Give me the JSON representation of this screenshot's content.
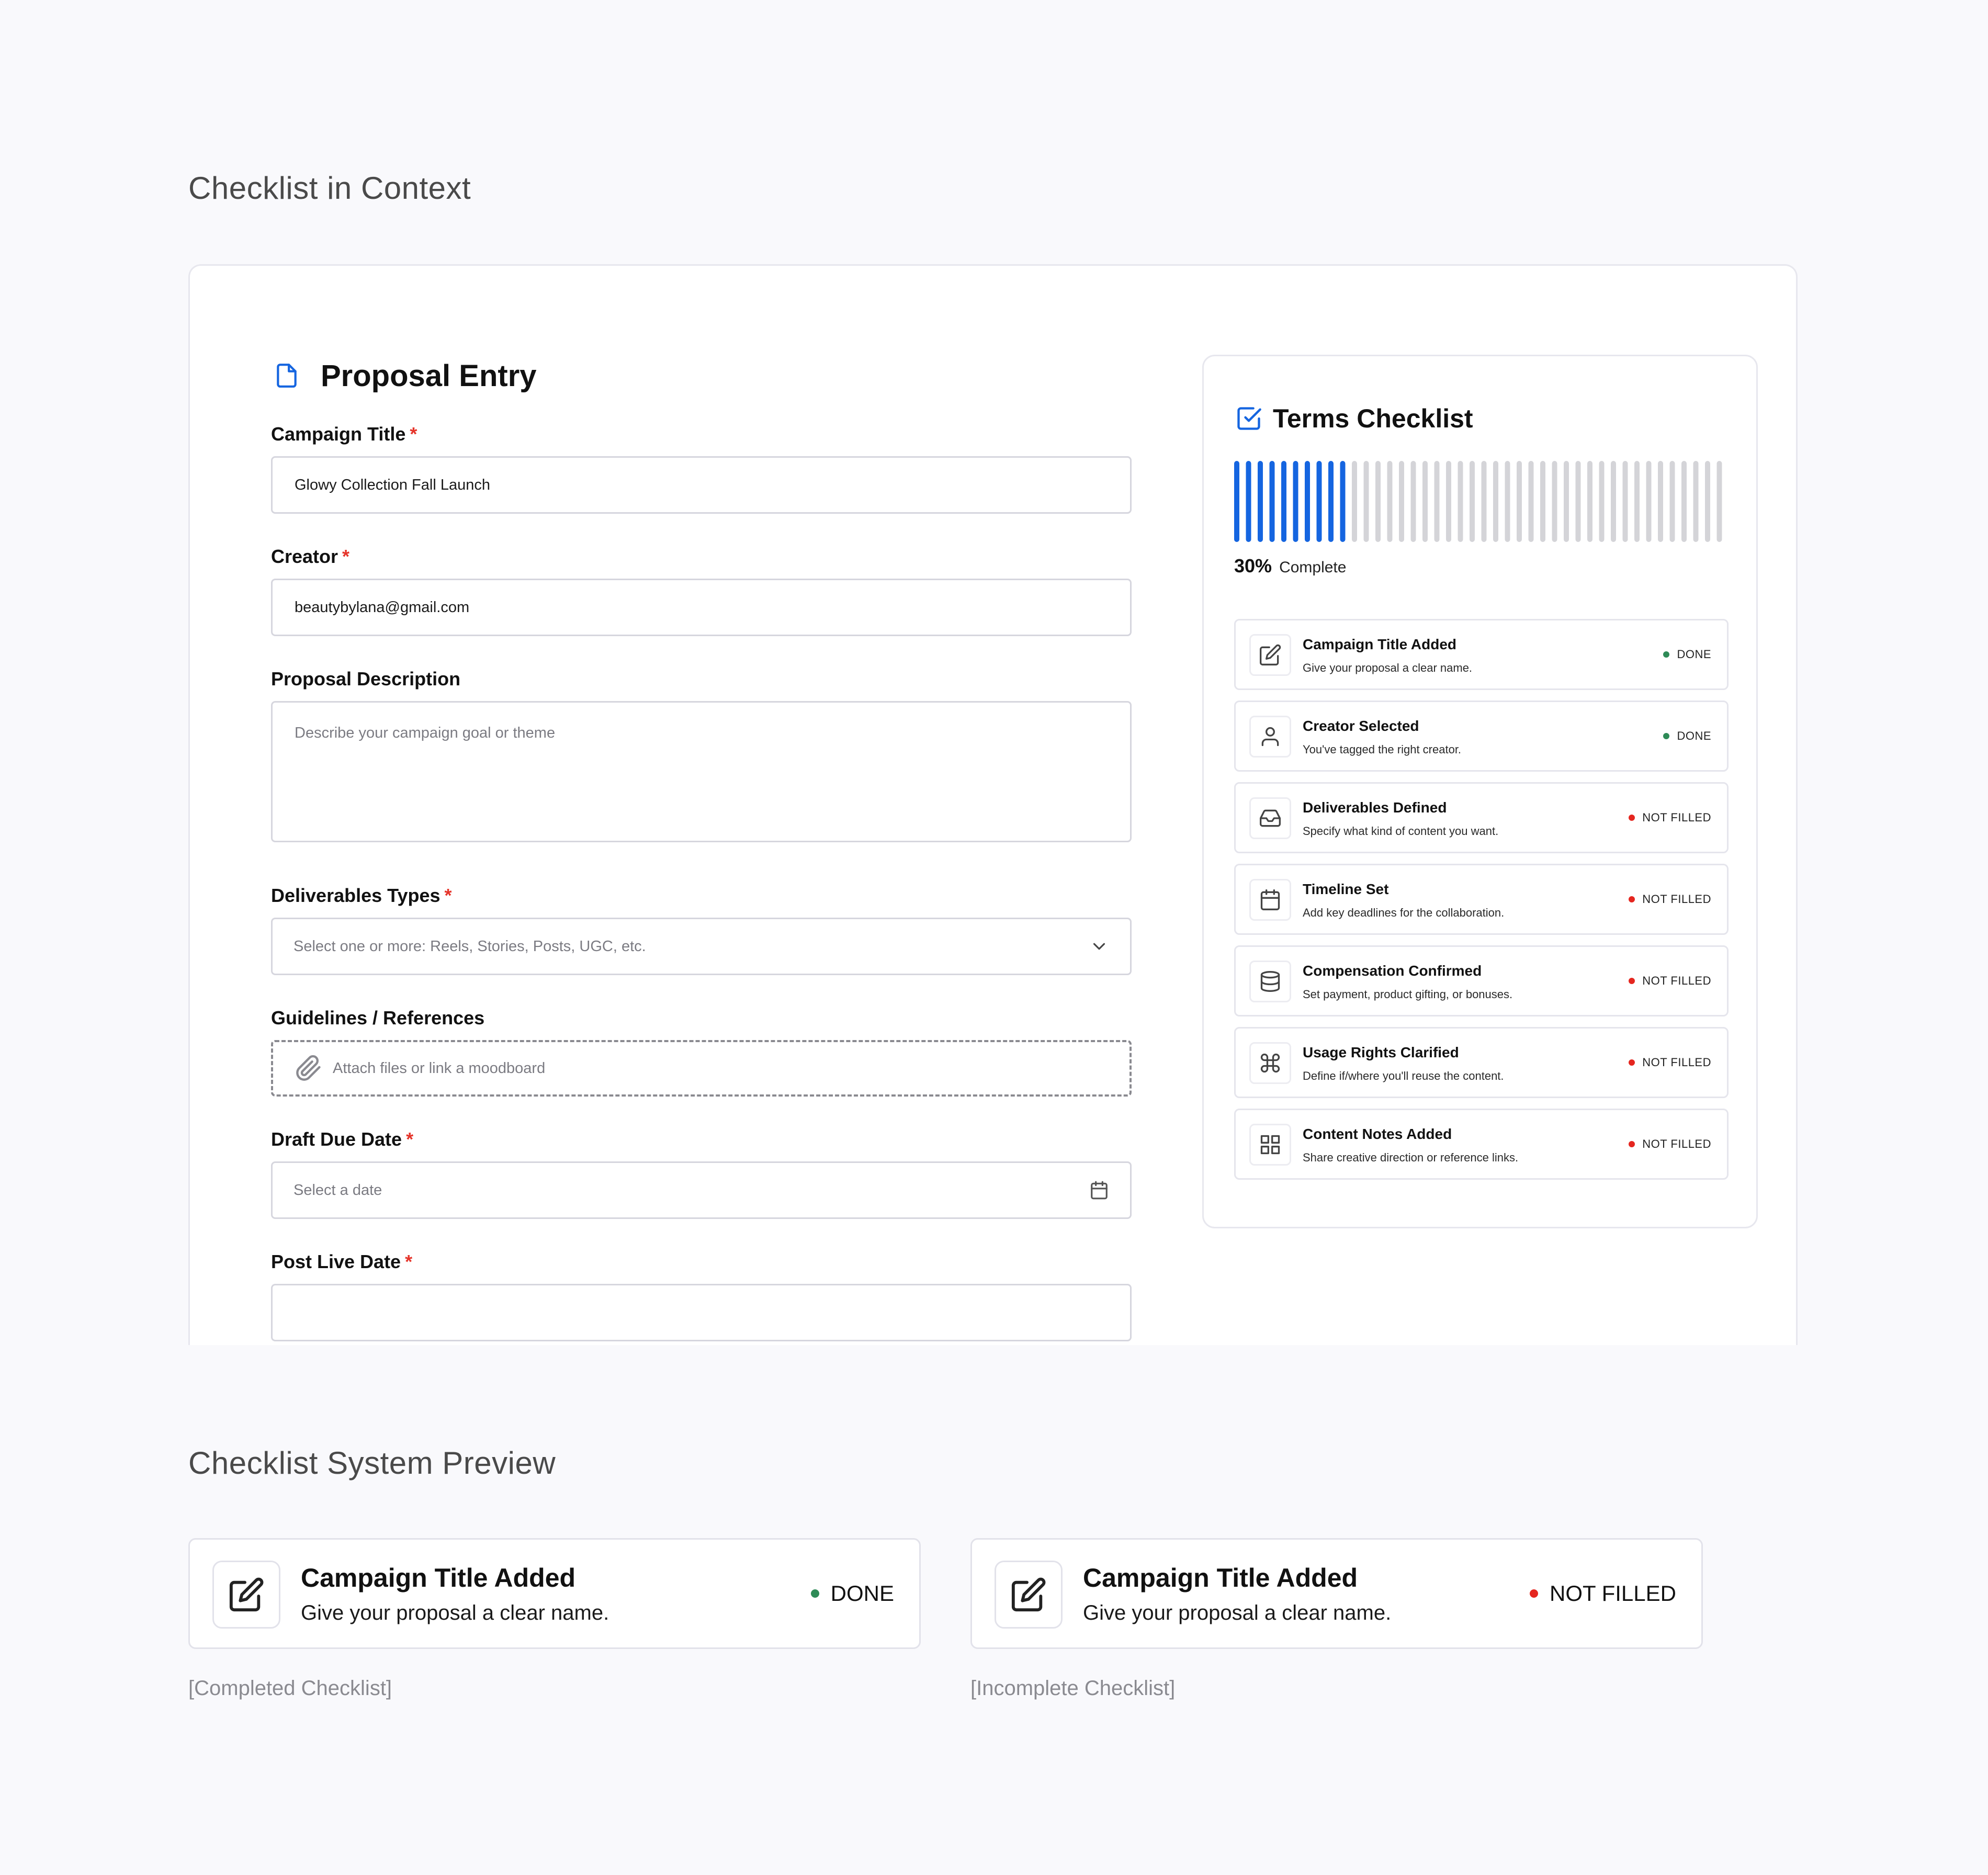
{
  "sections": {
    "context_title": "Checklist in Context",
    "preview_title": "Checklist System Preview"
  },
  "form": {
    "title": "Proposal Entry",
    "required_marker": "*",
    "fields": {
      "campaign_title": {
        "label": "Campaign Title",
        "value": "Glowy Collection Fall Launch"
      },
      "creator": {
        "label": "Creator",
        "value": "beautybylana@gmail.com"
      },
      "description": {
        "label": "Proposal Description",
        "placeholder": "Describe your campaign goal or theme"
      },
      "deliverables": {
        "label": "Deliverables Types",
        "placeholder": "Select one or more: Reels, Stories, Posts, UGC, etc."
      },
      "guidelines": {
        "label": "Guidelines / References",
        "placeholder": "Attach files or link a moodboard"
      },
      "draft_due": {
        "label": "Draft Due Date",
        "placeholder": "Select a date"
      },
      "post_live": {
        "label": "Post Live Date"
      }
    }
  },
  "checklist": {
    "title": "Terms Checklist",
    "progress_percent": 30,
    "progress_value": "30%",
    "progress_label": "Complete",
    "bar_count": 43,
    "filled_count": 10,
    "colors": {
      "filled": "#1565e0",
      "empty": "#d4d4d8",
      "done": "#2e8b57",
      "not_filled": "#e5261f"
    },
    "items": [
      {
        "icon": "edit-icon",
        "title": "Campaign Title Added",
        "desc": "Give your proposal a clear name.",
        "status": "DONE"
      },
      {
        "icon": "user-icon",
        "title": "Creator Selected",
        "desc": "You've tagged the right creator.",
        "status": "DONE"
      },
      {
        "icon": "inbox-icon",
        "title": "Deliverables Defined",
        "desc": "Specify what kind of content you want.",
        "status": "NOT FILLED"
      },
      {
        "icon": "calendar-icon",
        "title": "Timeline Set",
        "desc": "Add key deadlines for the collaboration.",
        "status": "NOT FILLED"
      },
      {
        "icon": "database-icon",
        "title": "Compensation Confirmed",
        "desc": "Set payment, product gifting, or bonuses.",
        "status": "NOT FILLED"
      },
      {
        "icon": "command-icon",
        "title": "Usage Rights Clarified",
        "desc": "Define if/where you'll reuse the content.",
        "status": "NOT FILLED"
      },
      {
        "icon": "grid-icon",
        "title": "Content Notes Added",
        "desc": "Share creative direction or reference links.",
        "status": "NOT FILLED"
      }
    ]
  },
  "preview": {
    "completed": {
      "title": "Campaign Title Added",
      "desc": "Give your proposal a clear name.",
      "status": "DONE",
      "caption": "[Completed Checklist]"
    },
    "incomplete": {
      "title": "Campaign Title Added",
      "desc": "Give your proposal a clear name.",
      "status": "NOT FILLED",
      "caption": "[Incomplete Checklist]"
    }
  }
}
